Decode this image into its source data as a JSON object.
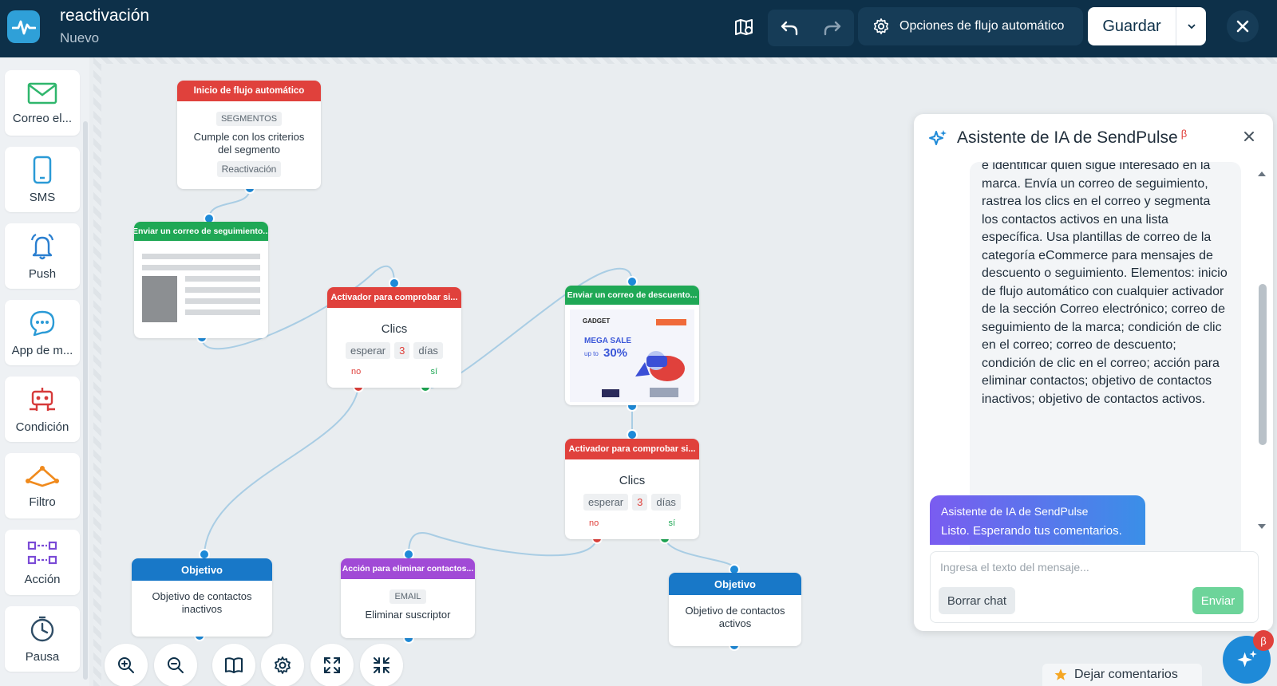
{
  "header": {
    "title": "reactivación",
    "subtitle": "Nuevo",
    "options_label": "Opciones de flujo automático",
    "save_label": "Guardar"
  },
  "palette": [
    {
      "label": "Correo el...",
      "icon": "mail-icon"
    },
    {
      "label": "SMS",
      "icon": "phone-icon"
    },
    {
      "label": "Push",
      "icon": "bell-icon"
    },
    {
      "label": "App de m...",
      "icon": "chat-bubble-icon"
    },
    {
      "label": "Condición",
      "icon": "robot-icon"
    },
    {
      "label": "Filtro",
      "icon": "filter-icon"
    },
    {
      "label": "Acción",
      "icon": "action-icon"
    },
    {
      "label": "Pausa",
      "icon": "clock-icon"
    }
  ],
  "flow": {
    "start": {
      "header": "Inicio de flujo automático",
      "tag": "SEGMENTOS",
      "text": "Cumple con los criterios del segmento",
      "chip": "Reactivación"
    },
    "email1": {
      "header": "Enviar un correo de seguimiento..."
    },
    "trigger1": {
      "header": "Activador para comprobar si...",
      "title": "Clics",
      "wait": "esperar",
      "count": "3",
      "unit": "días",
      "no": "no",
      "yes": "sí"
    },
    "email2": {
      "header": "Enviar un correo de descuento...",
      "brand": "GADGET",
      "promo": "MEGA SALE",
      "upto": "up to",
      "discount": "30%"
    },
    "trigger2": {
      "header": "Activador para comprobar si...",
      "title": "Clics",
      "wait": "esperar",
      "count": "3",
      "unit": "días",
      "no": "no",
      "yes": "sí"
    },
    "goal1": {
      "header": "Objetivo",
      "text": "Objetivo de contactos inactivos"
    },
    "action": {
      "header": "Acción para eliminar contactos...",
      "tag": "EMAIL",
      "text": "Eliminar suscriptor"
    },
    "goal2": {
      "header": "Objetivo",
      "text": "Objetivo de contactos activos"
    }
  },
  "ai": {
    "title": "Asistente de IA de SendPulse",
    "beta": "β",
    "message": "e identificar quién sigue interesado en la marca. Envía un correo de seguimiento, rastrea los clics en el correo y segmenta los contactos activos en una lista específica. Usa plantillas de correo de la categoría eCommerce para mensajes de descuento o seguimiento. Elementos: inicio de flujo automático con cualquier activador de la sección Correo electrónico; correo de seguimiento de la marca; condición de clic en el correo; correo de descuento; condición de clic en el correo; acción para eliminar contactos; objetivo de contactos inactivos; objetivo de contactos activos.",
    "bot_name": "Asistente de IA de SendPulse",
    "bot_status": "Listo. Esperando tus comentarios.",
    "input_placeholder": "Ingresa el texto del mensaje...",
    "clear_label": "Borrar chat",
    "send_label": "Enviar",
    "fab_badge": "β"
  },
  "feedback_label": "Dejar comentarios",
  "colors": {
    "topbar": "#0d3049",
    "red": "#e0413c",
    "green": "#1fa855",
    "blue": "#1878c8",
    "purple": "#a14ad6"
  }
}
